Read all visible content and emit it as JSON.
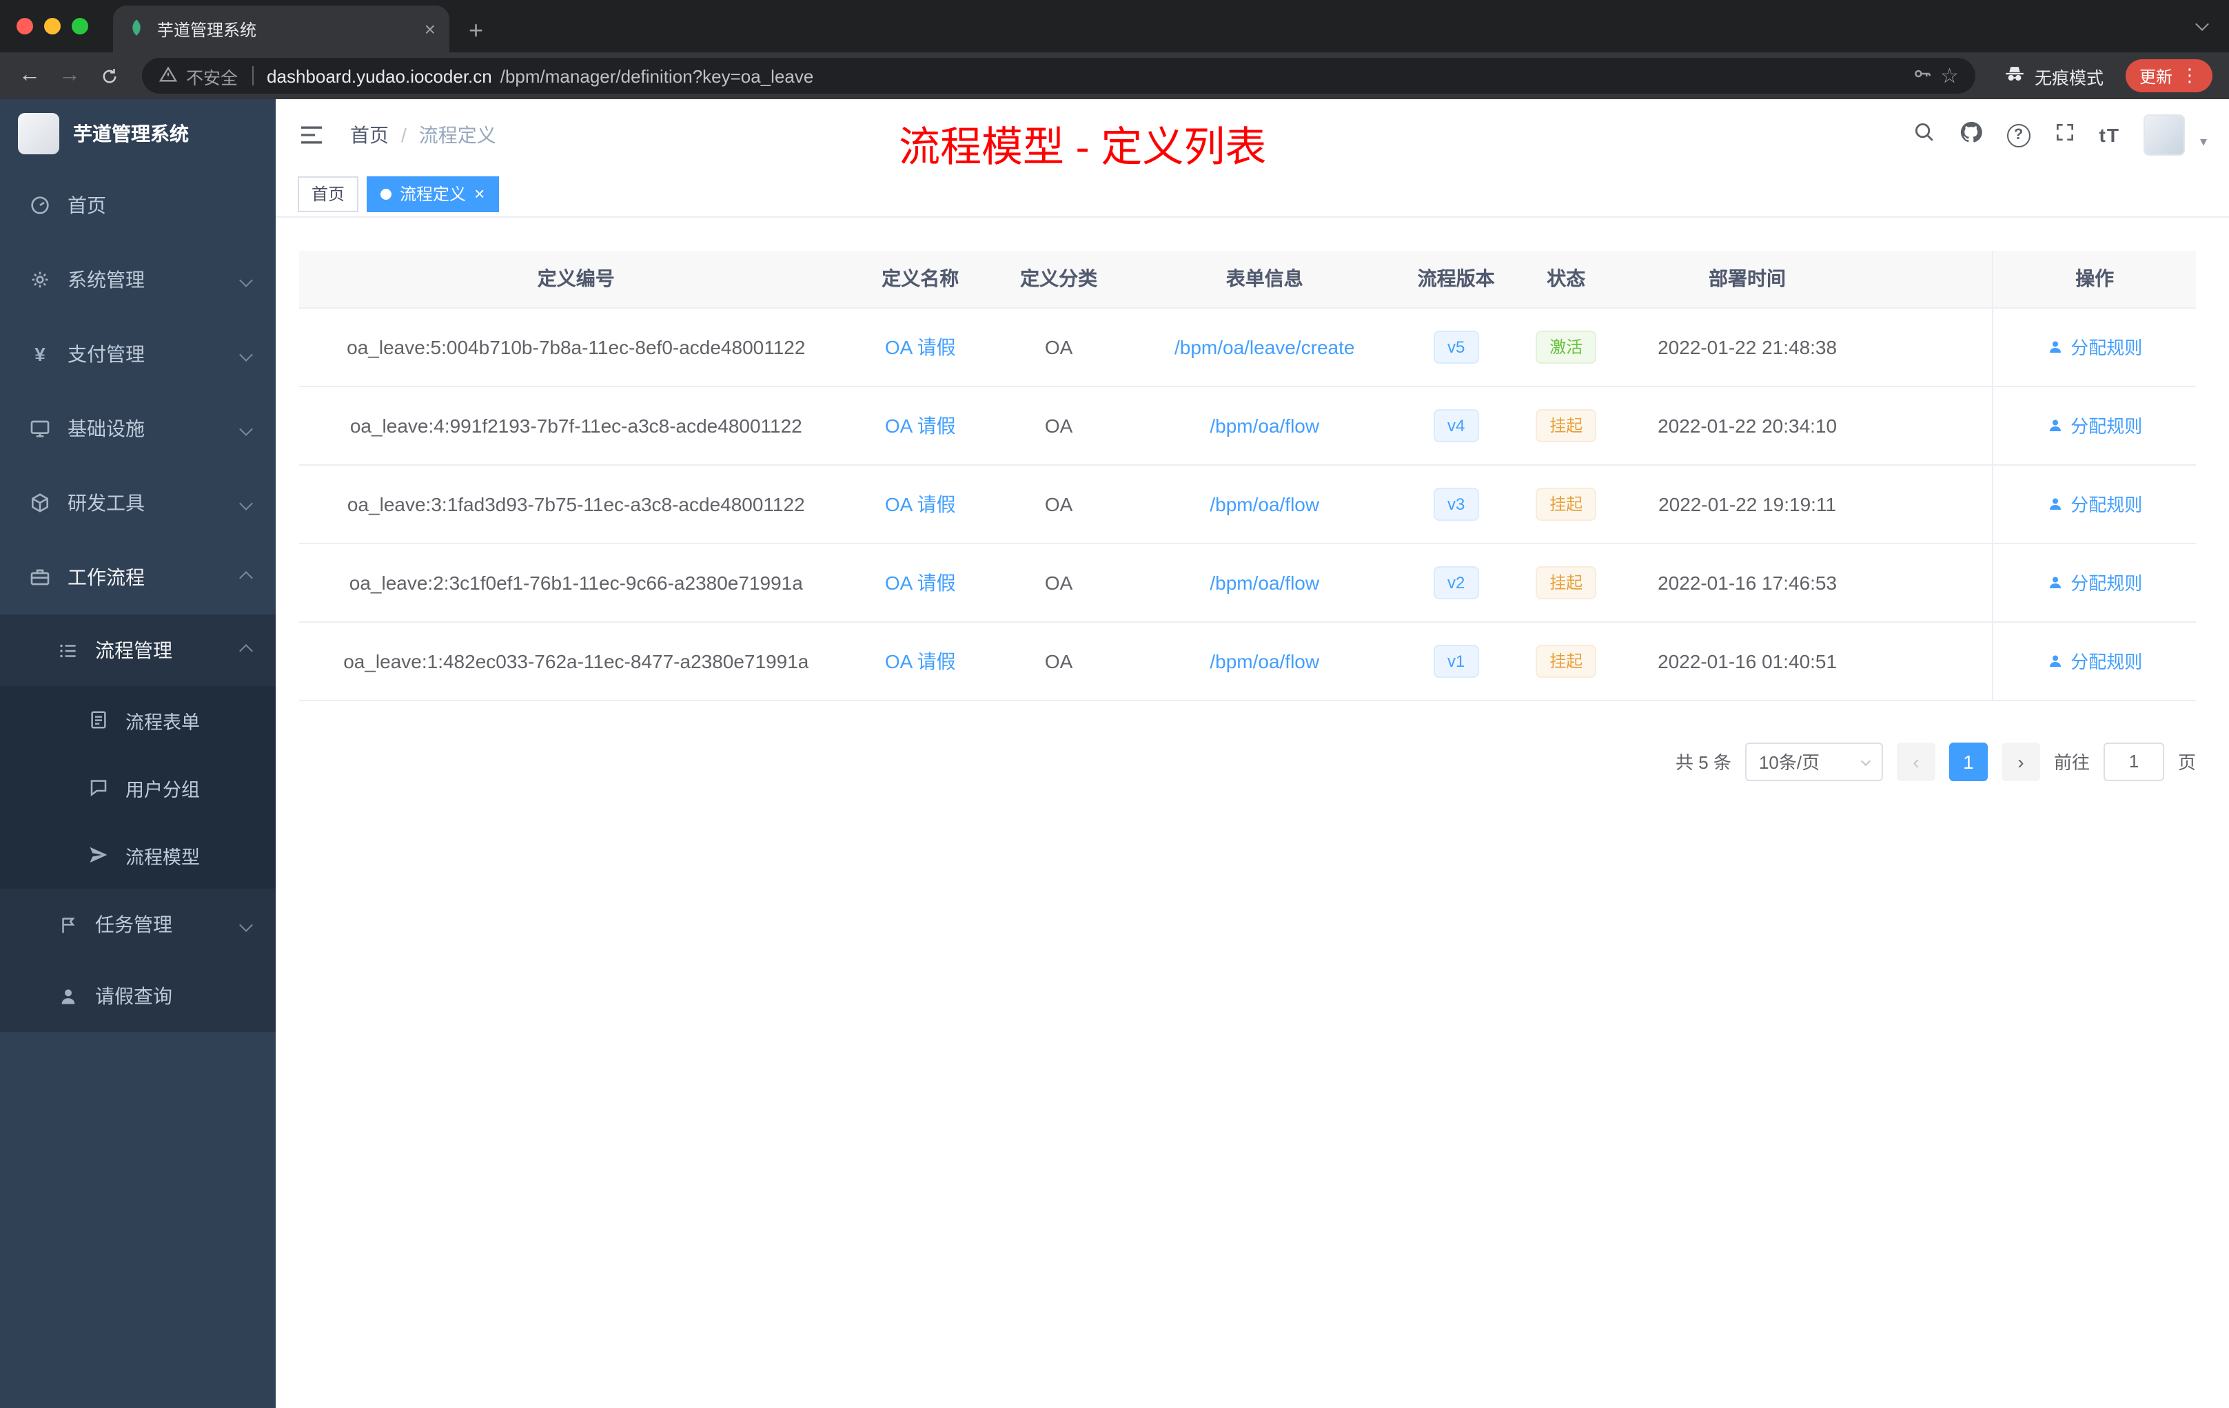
{
  "colors": {
    "accent_blue": "#409eff",
    "success_green": "#67c23a",
    "warning_orange": "#e6a23c",
    "annotation_red": "#ff0000",
    "sidebar_bg": "#304156",
    "update_button_red": "#dd4f43"
  },
  "icons": {
    "close": "×",
    "new_tab": "+",
    "back": "←",
    "forward": "→",
    "star": "☆",
    "menu_dots": "⋮",
    "question": "?",
    "font_size": "tT",
    "prev": "‹",
    "next": "›",
    "caret_down": "▾",
    "yen": "¥"
  },
  "browser": {
    "tab_title": "芋道管理系统",
    "security_label": "不安全",
    "url_host": "dashboard.yudao.iocoder.cn",
    "url_path": "/bpm/manager/definition?key=oa_leave",
    "incognito_label": "无痕模式",
    "update_label": "更新"
  },
  "sidebar": {
    "logo_title": "芋道管理系统",
    "menu": {
      "home": "首页",
      "system": "系统管理",
      "payment": "支付管理",
      "infra": "基础设施",
      "devtools": "研发工具",
      "workflow": "工作流程",
      "process_mgmt": "流程管理",
      "process_form": "流程表单",
      "user_group": "用户分组",
      "process_model": "流程模型",
      "task_mgmt": "任务管理",
      "leave_query": "请假查询"
    }
  },
  "header": {
    "breadcrumb_home": "首页",
    "breadcrumb_sep": "/",
    "breadcrumb_current": "流程定义",
    "annotation": "流程模型 - 定义列表"
  },
  "tags": {
    "home": "首页",
    "current": "流程定义"
  },
  "table": {
    "columns": {
      "id": "定义编号",
      "name": "定义名称",
      "category": "定义分类",
      "form": "表单信息",
      "version": "流程版本",
      "status": "状态",
      "deploy_time": "部署时间",
      "action": "操作"
    },
    "rows": [
      {
        "id": "oa_leave:5:004b710b-7b8a-11ec-8ef0-acde48001122",
        "name": "OA 请假",
        "category": "OA",
        "form": "/bpm/oa/leave/create",
        "version": "v5",
        "status": "激活",
        "status_class": "tag green",
        "deploy_time": "2022-01-22 21:48:38",
        "action": "分配规则"
      },
      {
        "id": "oa_leave:4:991f2193-7b7f-11ec-a3c8-acde48001122",
        "name": "OA 请假",
        "category": "OA",
        "form": "/bpm/oa/flow",
        "version": "v4",
        "status": "挂起",
        "status_class": "tag yellow",
        "deploy_time": "2022-01-22 20:34:10",
        "action": "分配规则"
      },
      {
        "id": "oa_leave:3:1fad3d93-7b75-11ec-a3c8-acde48001122",
        "name": "OA 请假",
        "category": "OA",
        "form": "/bpm/oa/flow",
        "version": "v3",
        "status": "挂起",
        "status_class": "tag yellow",
        "deploy_time": "2022-01-22 19:19:11",
        "action": "分配规则"
      },
      {
        "id": "oa_leave:2:3c1f0ef1-76b1-11ec-9c66-a2380e71991a",
        "name": "OA 请假",
        "category": "OA",
        "form": "/bpm/oa/flow",
        "version": "v2",
        "status": "挂起",
        "status_class": "tag yellow",
        "deploy_time": "2022-01-16 17:46:53",
        "action": "分配规则"
      },
      {
        "id": "oa_leave:1:482ec033-762a-11ec-8477-a2380e71991a",
        "name": "OA 请假",
        "category": "OA",
        "form": "/bpm/oa/flow",
        "version": "v1",
        "status": "挂起",
        "status_class": "tag yellow",
        "deploy_time": "2022-01-16 01:40:51",
        "action": "分配规则"
      }
    ]
  },
  "pagination": {
    "total": "共 5 条",
    "page_size": "10条/页",
    "page": "1",
    "goto_label": "前往",
    "goto_value": "1",
    "unit": "页"
  }
}
